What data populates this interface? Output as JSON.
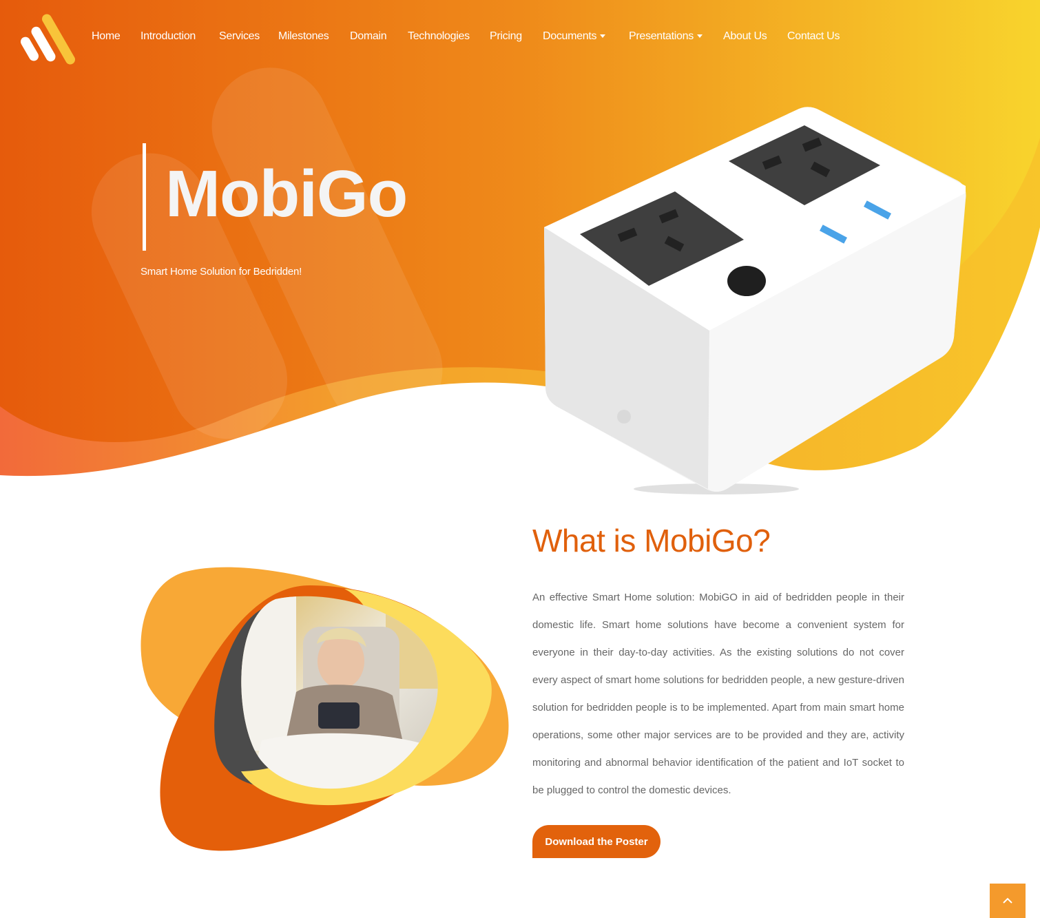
{
  "nav": {
    "items": [
      {
        "label": "Home"
      },
      {
        "label": "Introduction"
      },
      {
        "label": "Services"
      },
      {
        "label": "Milestones"
      },
      {
        "label": "Domain"
      },
      {
        "label": "Technologies"
      },
      {
        "label": "Pricing"
      },
      {
        "label": "Documents"
      },
      {
        "label": "Presentations"
      },
      {
        "label": "About Us"
      },
      {
        "label": "Contact Us"
      }
    ]
  },
  "hero": {
    "title": "MobiGo",
    "subtitle": "Smart Home Solution for Bedridden!"
  },
  "about": {
    "title": "What is MobiGo?",
    "body": "An effective Smart Home solution: MobiGO in aid of bedridden people in their domestic life. Smart home solutions have become a convenient system for everyone in their day-to-day activities. As the existing solutions do not cover every aspect of smart home solutions for bedridden people, a new gesture-driven solution for bedridden people is to be implemented. Apart from main smart home operations, some other major services are to be provided and they are, activity monitoring and abnormal behavior identification of the patient and IoT socket to be plugged to control the domestic devices.",
    "button": "Download the Poster"
  },
  "colors": {
    "brand_orange": "#e2620c",
    "brand_yellow": "#f7d12e",
    "text_gray": "#666666"
  },
  "icons": {
    "logo": "brand-stripes-logo",
    "scroll_top": "chevron-up-icon",
    "dropdown": "caret-down-icon"
  }
}
